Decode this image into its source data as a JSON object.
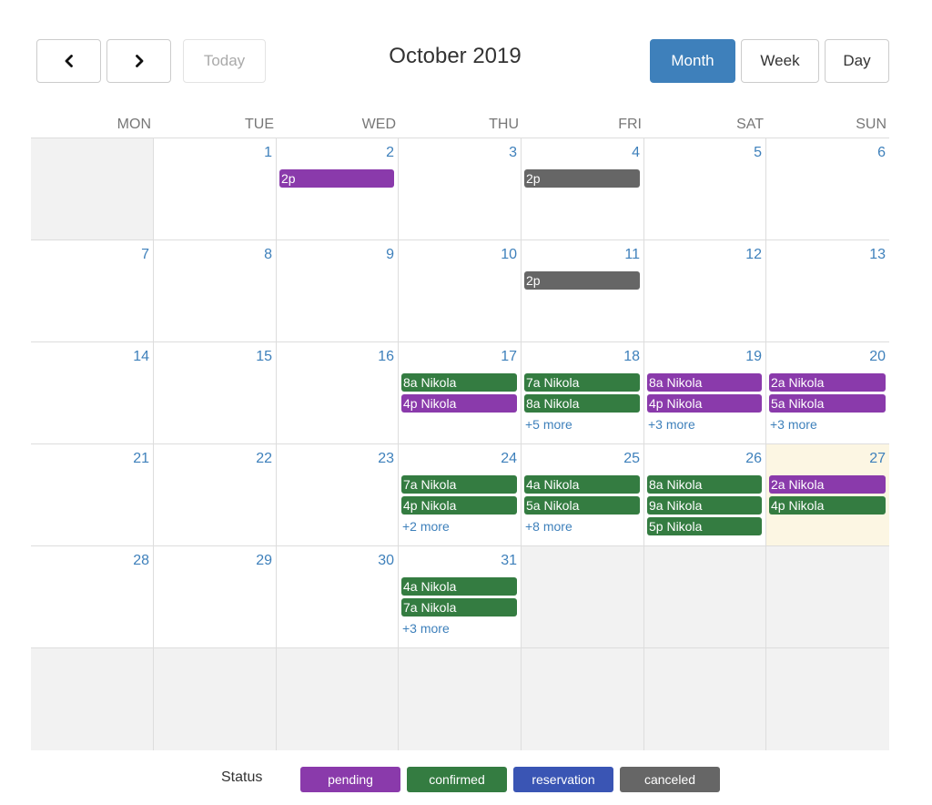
{
  "toolbar": {
    "prev_icon": "chevron-left-icon",
    "next_icon": "chevron-right-icon",
    "today_label": "Today",
    "title": "October 2019",
    "views": [
      "Month",
      "Week",
      "Day"
    ],
    "active_view": "Month"
  },
  "days_of_week": [
    "MON",
    "TUE",
    "WED",
    "THU",
    "FRI",
    "SAT",
    "SUN"
  ],
  "colors": {
    "pending": "#8a3aab",
    "confirmed": "#347c41",
    "reservation": "#3a55b4",
    "canceled": "#666666",
    "accent": "#3e80bb",
    "today_bg": "#fcf6e3",
    "other_month_bg": "#f2f2f2"
  },
  "weeks": [
    [
      {
        "day": "",
        "other": true
      },
      {
        "day": "1",
        "events": []
      },
      {
        "day": "2",
        "events": [
          {
            "label": "2p",
            "status": "pending"
          }
        ]
      },
      {
        "day": "3",
        "events": []
      },
      {
        "day": "4",
        "events": [
          {
            "label": "2p",
            "status": "canceled"
          }
        ]
      },
      {
        "day": "5",
        "events": []
      },
      {
        "day": "6",
        "events": []
      }
    ],
    [
      {
        "day": "7",
        "events": []
      },
      {
        "day": "8",
        "events": []
      },
      {
        "day": "9",
        "events": []
      },
      {
        "day": "10",
        "events": []
      },
      {
        "day": "11",
        "events": [
          {
            "label": "2p",
            "status": "canceled"
          }
        ]
      },
      {
        "day": "12",
        "events": []
      },
      {
        "day": "13",
        "events": []
      }
    ],
    [
      {
        "day": "14",
        "events": []
      },
      {
        "day": "15",
        "events": []
      },
      {
        "day": "16",
        "events": []
      },
      {
        "day": "17",
        "events": [
          {
            "label": "8a Nikola",
            "status": "confirmed"
          },
          {
            "label": "4p Nikola",
            "status": "pending"
          }
        ]
      },
      {
        "day": "18",
        "events": [
          {
            "label": "7a Nikola",
            "status": "confirmed"
          },
          {
            "label": "8a Nikola",
            "status": "confirmed"
          }
        ],
        "more": "+5 more"
      },
      {
        "day": "19",
        "events": [
          {
            "label": "8a Nikola",
            "status": "pending"
          },
          {
            "label": "4p Nikola",
            "status": "pending"
          }
        ],
        "more": "+3 more"
      },
      {
        "day": "20",
        "events": [
          {
            "label": "2a Nikola",
            "status": "pending"
          },
          {
            "label": "5a Nikola",
            "status": "pending"
          }
        ],
        "more": "+3 more"
      }
    ],
    [
      {
        "day": "21",
        "events": []
      },
      {
        "day": "22",
        "events": []
      },
      {
        "day": "23",
        "events": []
      },
      {
        "day": "24",
        "events": [
          {
            "label": "7a Nikola",
            "status": "confirmed"
          },
          {
            "label": "4p Nikola",
            "status": "confirmed"
          }
        ],
        "more": "+2 more"
      },
      {
        "day": "25",
        "events": [
          {
            "label": "4a Nikola",
            "status": "confirmed"
          },
          {
            "label": "5a Nikola",
            "status": "confirmed"
          }
        ],
        "more": "+8 more"
      },
      {
        "day": "26",
        "events": [
          {
            "label": "8a Nikola",
            "status": "confirmed"
          },
          {
            "label": "9a Nikola",
            "status": "confirmed"
          },
          {
            "label": "5p Nikola",
            "status": "confirmed"
          }
        ]
      },
      {
        "day": "27",
        "today": true,
        "events": [
          {
            "label": "2a Nikola",
            "status": "pending"
          },
          {
            "label": "4p Nikola",
            "status": "confirmed"
          }
        ]
      }
    ],
    [
      {
        "day": "28",
        "events": []
      },
      {
        "day": "29",
        "events": []
      },
      {
        "day": "30",
        "events": []
      },
      {
        "day": "31",
        "events": [
          {
            "label": "4a Nikola",
            "status": "confirmed"
          },
          {
            "label": "7a Nikola",
            "status": "confirmed"
          }
        ],
        "more": "+3 more"
      },
      {
        "day": "",
        "other": true
      },
      {
        "day": "",
        "other": true
      },
      {
        "day": "",
        "other": true
      }
    ],
    [
      {
        "day": "",
        "other": true
      },
      {
        "day": "",
        "other": true
      },
      {
        "day": "",
        "other": true
      },
      {
        "day": "",
        "other": true
      },
      {
        "day": "",
        "other": true
      },
      {
        "day": "",
        "other": true
      },
      {
        "day": "",
        "other": true
      }
    ]
  ],
  "legend": {
    "label": "Status",
    "items": [
      {
        "key": "pending",
        "label": "pending"
      },
      {
        "key": "confirmed",
        "label": "confirmed"
      },
      {
        "key": "reservation",
        "label": "reservation"
      },
      {
        "key": "canceled",
        "label": "canceled"
      }
    ]
  }
}
